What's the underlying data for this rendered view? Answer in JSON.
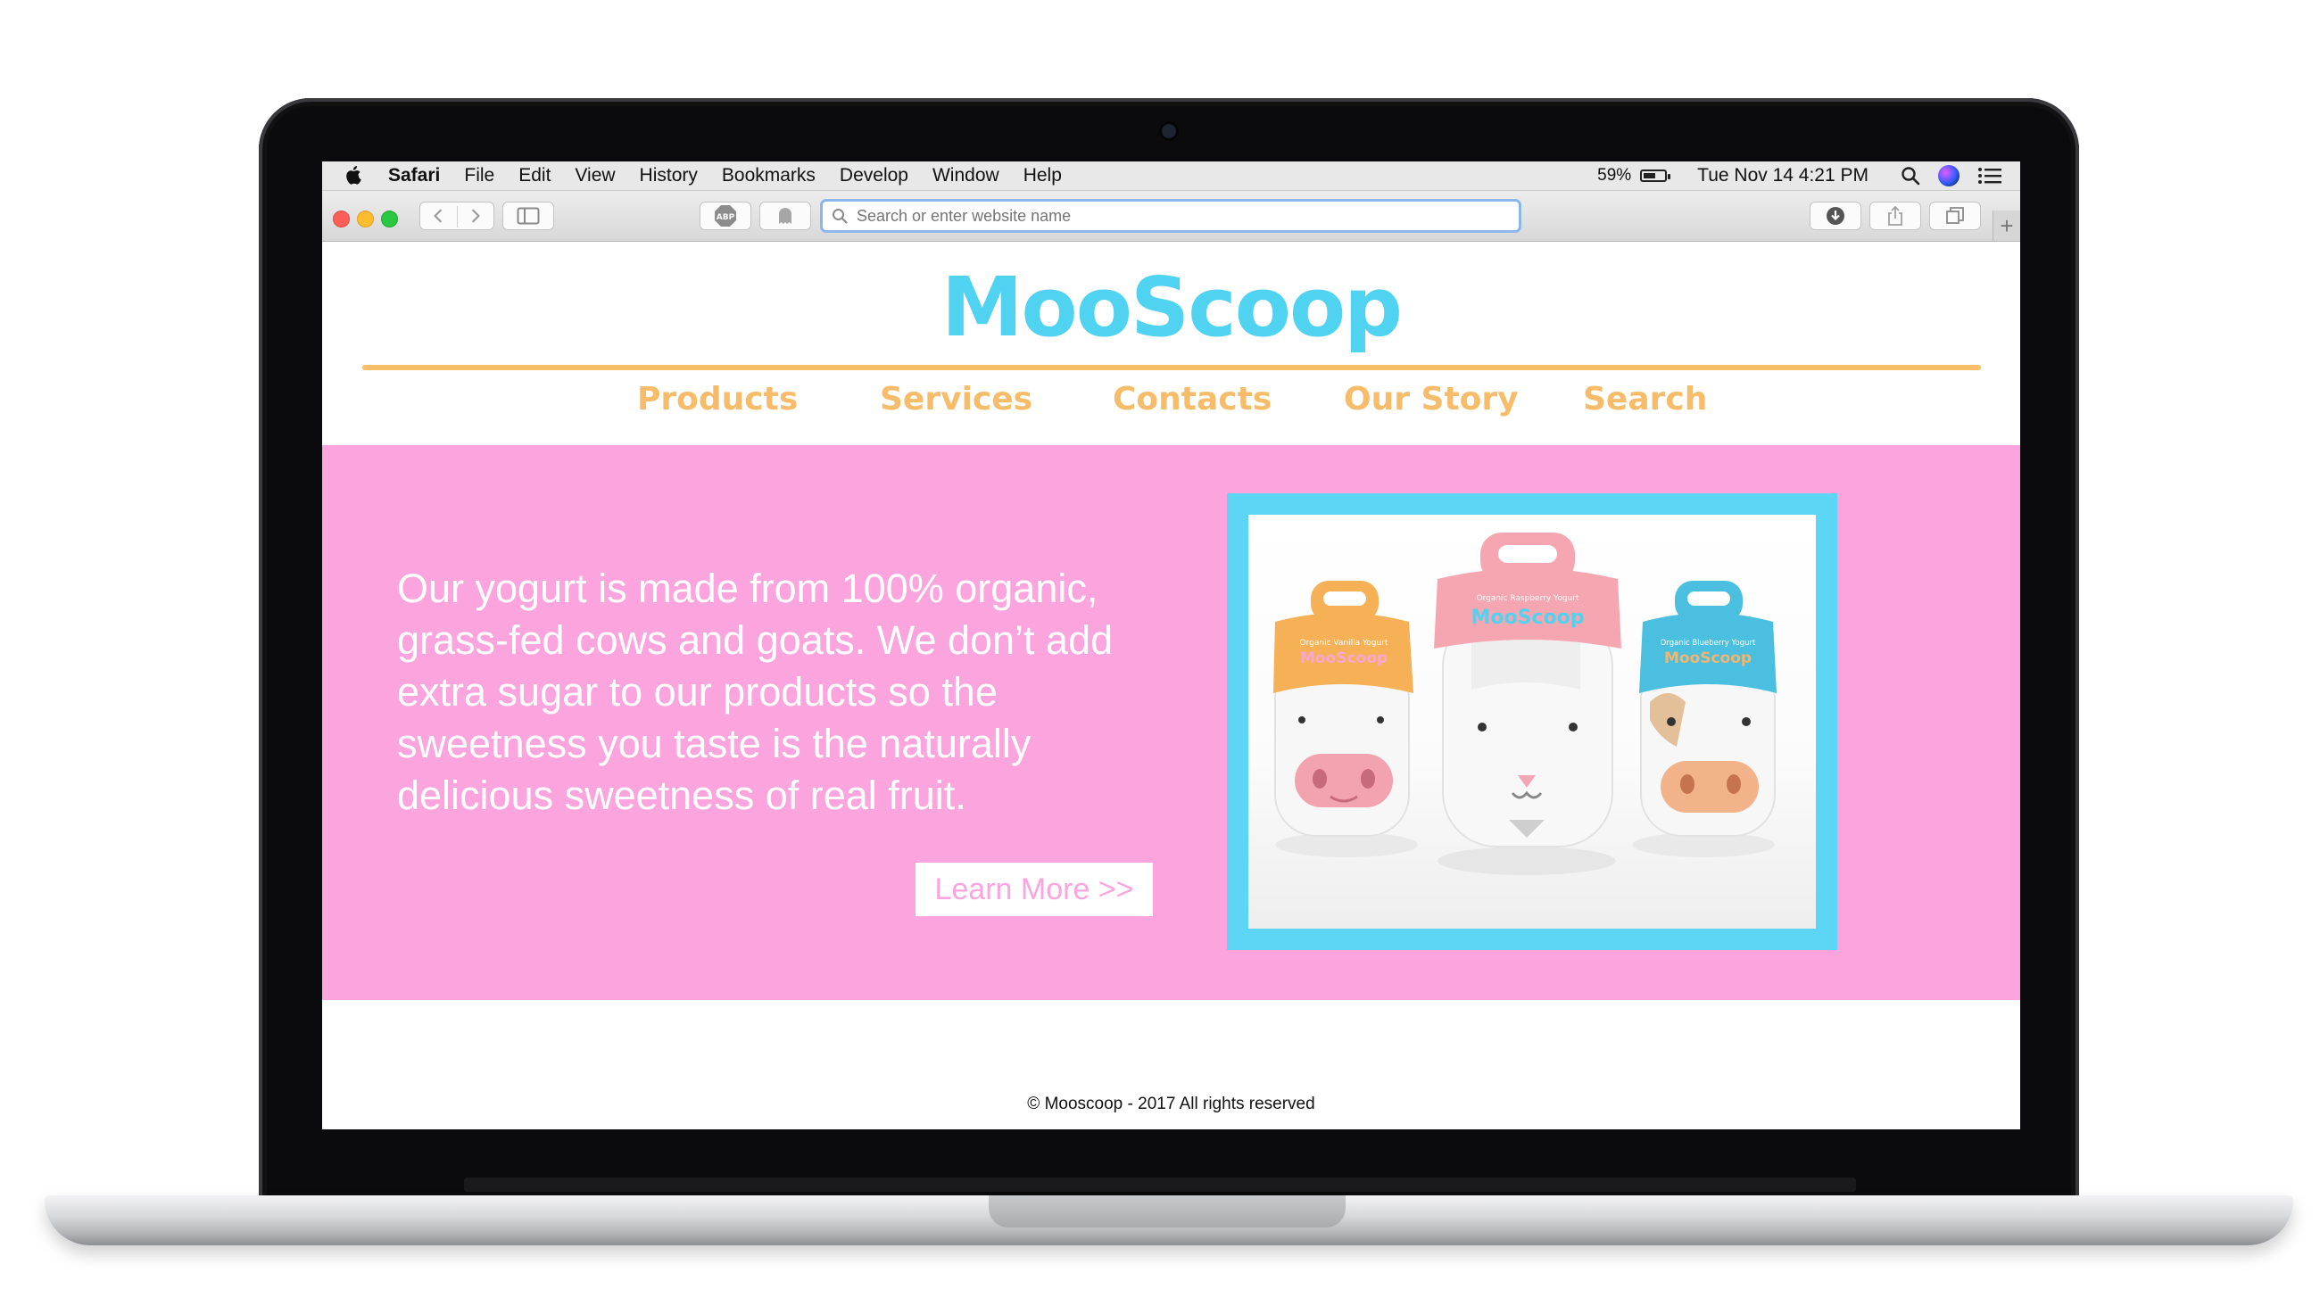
{
  "macos_menubar": {
    "app_name": "Safari",
    "menus": [
      "File",
      "Edit",
      "View",
      "History",
      "Bookmarks",
      "Develop",
      "Window",
      "Help"
    ],
    "battery_percent": "59%",
    "battery_level": 0.59,
    "datetime": "Tue Nov 14  4:21 PM"
  },
  "browser": {
    "address_placeholder": "Search or enter website name",
    "adblock_label": "ABP"
  },
  "site": {
    "logo_text": "MooScoop",
    "nav": [
      "Products",
      "Services",
      "Contacts",
      "Our Story",
      "Search"
    ],
    "hero_text": "Our yogurt is made from 100% organic, grass-fed cows and goats. We don’t add extra sugar to our products so the sweetness you taste is the naturally delicious sweetness of real fruit.",
    "cta_label": "Learn More >>",
    "product_labels": [
      "Organic Vanilla Yogurt",
      "Organic Raspberry Yogurt",
      "Organic Blueberry Yogurt"
    ],
    "product_brand": "MooScoop",
    "footer": "© Mooscoop - 2017 All rights reserved"
  },
  "colors": {
    "brand_cyan": "#4fd3f1",
    "nav_orange": "#f7bc6a",
    "hero_pink": "#fca4dd",
    "frame_blue": "#5dd6f5"
  }
}
